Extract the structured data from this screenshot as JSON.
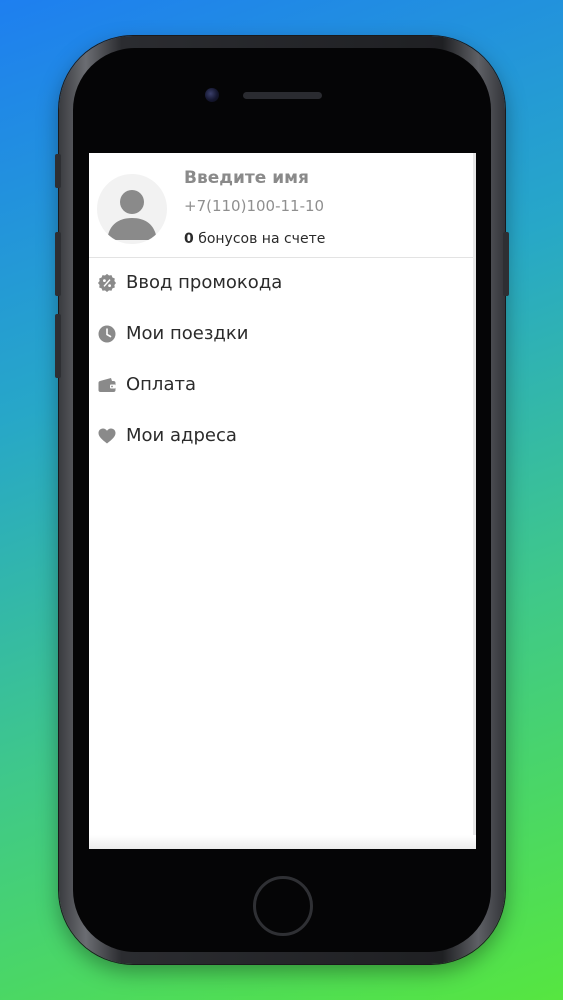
{
  "profile": {
    "name_placeholder": "Введите имя",
    "phone": "+7(110)100-11-10",
    "bonus_count": "0",
    "bonus_text": "бонусов на счете",
    "avatar_icon": "person-icon"
  },
  "menu": {
    "items": [
      {
        "label": "Ввод промокода",
        "icon": "promo-badge-icon"
      },
      {
        "label": "Мои поездки",
        "icon": "clock-icon"
      },
      {
        "label": "Оплата",
        "icon": "wallet-icon"
      },
      {
        "label": "Мои адреса",
        "icon": "heart-icon"
      }
    ]
  },
  "colors": {
    "icon_gray": "#8a8a8a",
    "text_dark": "#2b2b2b",
    "gradient_top": "#1e7ff0",
    "gradient_bottom": "#56e640"
  }
}
